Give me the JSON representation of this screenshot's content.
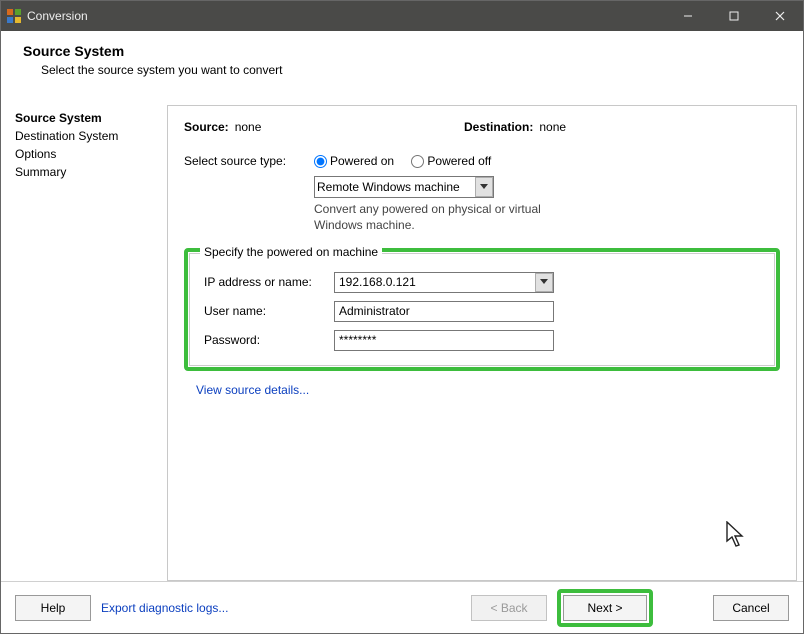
{
  "window": {
    "title": "Conversion"
  },
  "header": {
    "title": "Source System",
    "subtitle": "Select the source system you want to convert"
  },
  "sidebar": {
    "items": [
      "Source System",
      "Destination System",
      "Options",
      "Summary"
    ],
    "current": 0
  },
  "srcdest": {
    "source_label": "Source:",
    "source_value": "none",
    "dest_label": "Destination:",
    "dest_value": "none"
  },
  "sourceType": {
    "label": "Select source type:",
    "radio_on": "Powered on",
    "radio_off": "Powered off",
    "selected": "on",
    "dropdown_value": "Remote Windows machine",
    "hint": "Convert any powered on physical or virtual Windows machine."
  },
  "fieldset": {
    "legend": "Specify the powered on machine",
    "ip_label": "IP address or name:",
    "ip_value": "192.168.0.121",
    "user_label": "User name:",
    "user_value": "Administrator",
    "pass_label": "Password:",
    "pass_value": "********"
  },
  "links": {
    "view_source": "View source details...",
    "export_diag": "Export diagnostic logs..."
  },
  "buttons": {
    "help": "Help",
    "back": "< Back",
    "next": "Next >",
    "cancel": "Cancel"
  }
}
